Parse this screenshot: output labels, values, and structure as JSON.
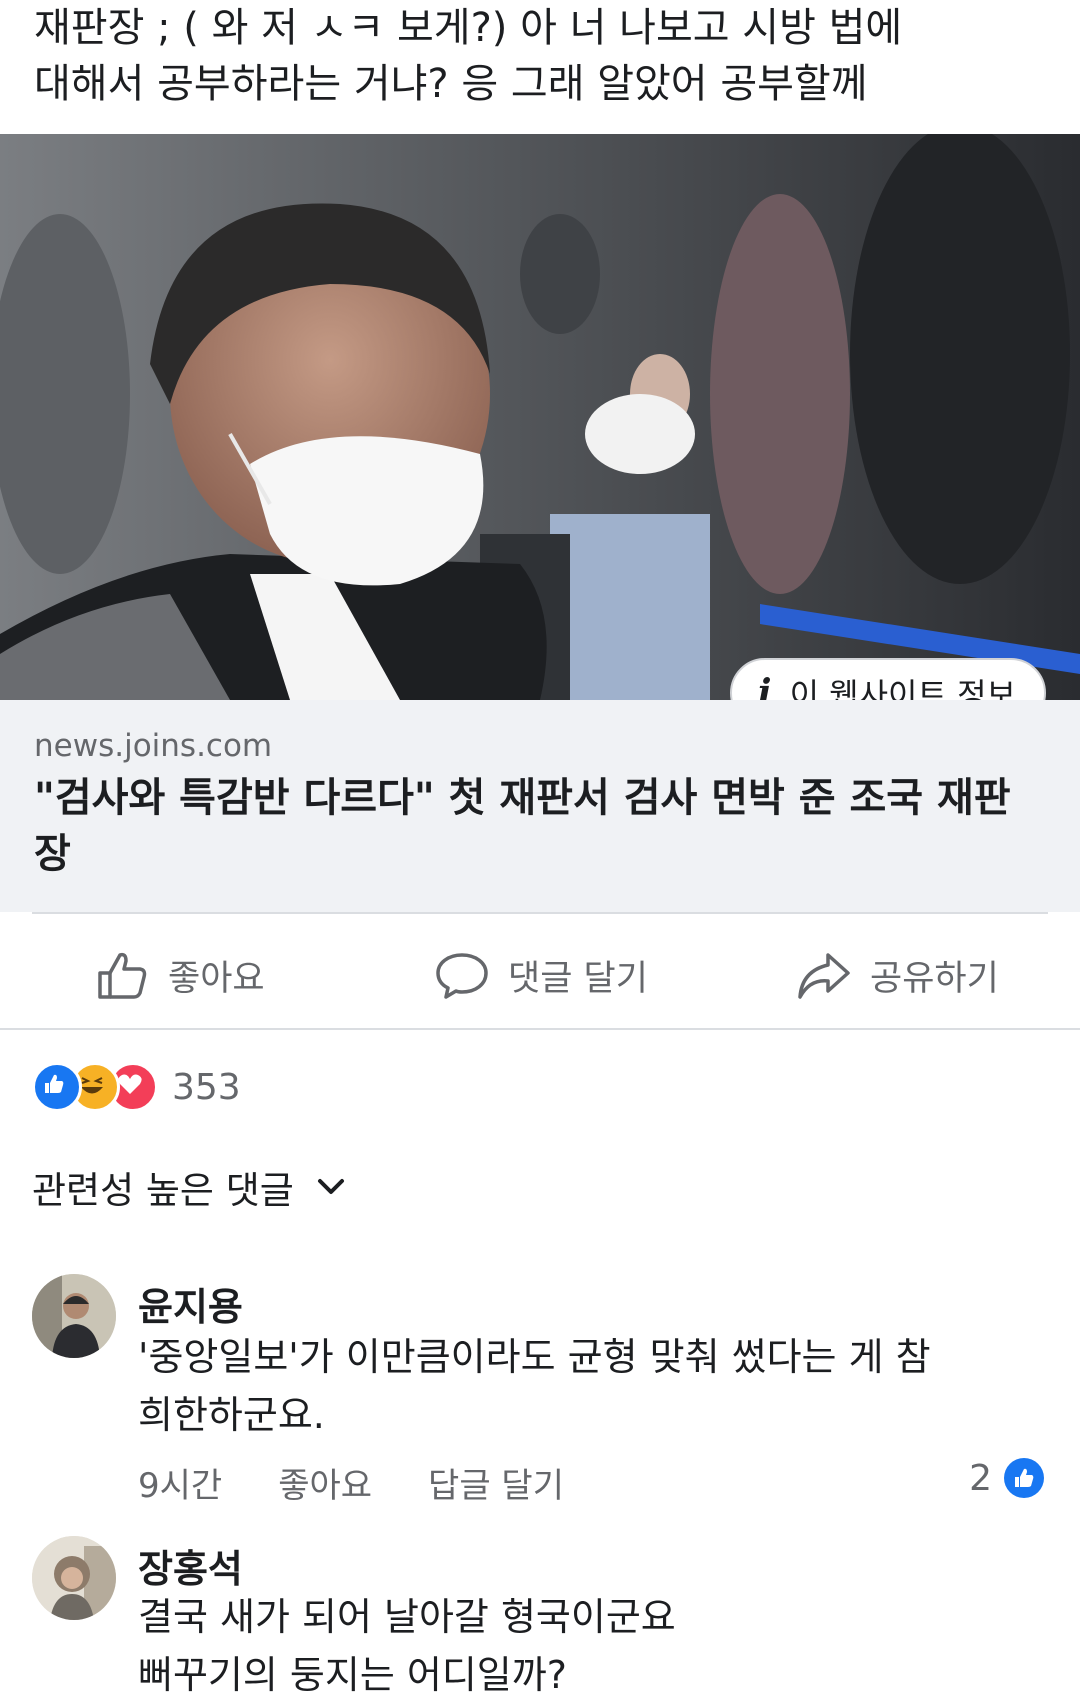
{
  "post": {
    "text": "재판장 ; ( 와 저 ㅅㅋ 보게?) 아 너 나보고 시방 법에\n대해서 공부하라는 거냐? 응 그래 알았어 공부할께"
  },
  "link_preview": {
    "site_info_label": "이 웹사이트 정보",
    "domain": "news.joins.com",
    "title": "\"검사와 특감반 다르다\" 첫 재판서 검사 면박 준 조국 재판장"
  },
  "actions": {
    "like": "좋아요",
    "comment": "댓글 달기",
    "share": "공유하기"
  },
  "reactions": {
    "count": "353",
    "icons": [
      "like-icon",
      "haha-icon",
      "love-icon"
    ],
    "colors": {
      "like": "#1877f2",
      "haha": "#f7b125",
      "love": "#f33e58"
    }
  },
  "comments_section": {
    "filter_label": "관련성 높은 댓글"
  },
  "comments": [
    {
      "author": "윤지용",
      "text": "'중앙일보'가 이만큼이라도 균형 맞춰 썼다는 게 참\n희한하군요.",
      "time": "9시간",
      "like_label": "좋아요",
      "reply_label": "답글 달기",
      "like_count": "2"
    },
    {
      "author": "장홍석",
      "text": "결국 새가 되어 날아갈 형국이군요\n뻐꾸기의 둥지는 어디일까?"
    }
  ]
}
